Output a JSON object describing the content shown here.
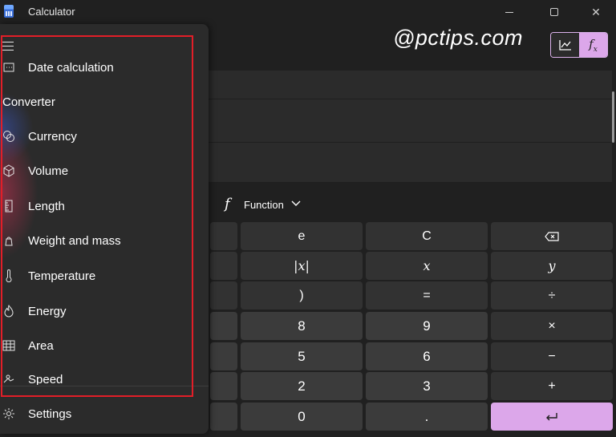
{
  "window": {
    "title": "Calculator",
    "controls": {
      "minimize": "minimize-icon",
      "maximize": "maximize-icon",
      "close": "✕"
    }
  },
  "watermark": "@pctips.com",
  "mode_toggle": {
    "graph_icon": "graph-icon",
    "function_label": "f",
    "function_sub": "x",
    "accent": "#dca7ea"
  },
  "function_bar": {
    "icon": "f",
    "label": "Function",
    "chevron": "⌵"
  },
  "keypad": {
    "rows": [
      [
        "",
        "e",
        "C",
        "⌫"
      ],
      [
        "",
        "|x|",
        "x",
        "y"
      ],
      [
        "",
        ")",
        "=",
        "÷"
      ],
      [
        "",
        "8",
        "9",
        "×"
      ],
      [
        "",
        "5",
        "6",
        "−"
      ],
      [
        "",
        "2",
        "3",
        "+"
      ],
      [
        "",
        "0",
        ".",
        "↵"
      ]
    ]
  },
  "sidebar": {
    "top_item": {
      "label": "Date calculation",
      "icon": "calendar-icon"
    },
    "section": "Converter",
    "items": [
      {
        "label": "Currency",
        "icon": "currency-icon"
      },
      {
        "label": "Volume",
        "icon": "cube-icon"
      },
      {
        "label": "Length",
        "icon": "ruler-icon"
      },
      {
        "label": "Weight and mass",
        "icon": "weight-icon"
      },
      {
        "label": "Temperature",
        "icon": "thermometer-icon"
      },
      {
        "label": "Energy",
        "icon": "flame-icon"
      },
      {
        "label": "Area",
        "icon": "grid-icon"
      },
      {
        "label": "Speed",
        "icon": "speed-icon"
      }
    ],
    "settings": {
      "label": "Settings",
      "icon": "gear-icon"
    },
    "highlight_color": "#e21e28"
  }
}
